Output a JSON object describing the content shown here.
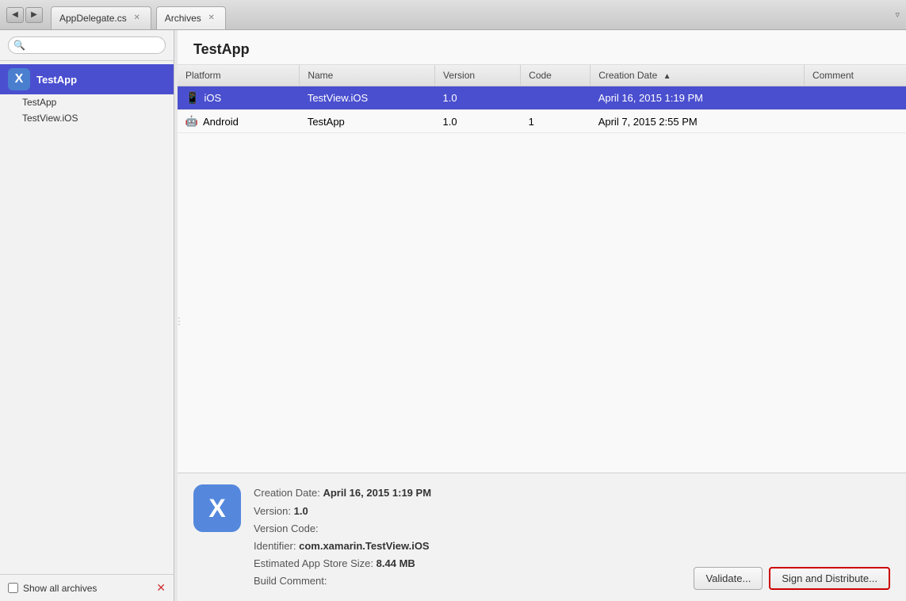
{
  "titleBar": {
    "tabs": [
      {
        "label": "AppDelegate.cs",
        "active": false
      },
      {
        "label": "Archives",
        "active": true
      }
    ]
  },
  "sidebar": {
    "searchPlaceholder": "",
    "groups": [
      {
        "label": "TestApp",
        "icon": "X",
        "children": [
          "TestApp",
          "TestView.iOS"
        ]
      }
    ],
    "showAllLabel": "Show all archives",
    "clearIcon": "✕"
  },
  "content": {
    "title": "TestApp",
    "table": {
      "columns": [
        {
          "label": "Platform",
          "sortable": false
        },
        {
          "label": "Name",
          "sortable": false
        },
        {
          "label": "Version",
          "sortable": false
        },
        {
          "label": "Code",
          "sortable": false
        },
        {
          "label": "Creation Date",
          "sortable": true,
          "sortDir": "asc"
        },
        {
          "label": "Comment",
          "sortable": false
        }
      ],
      "rows": [
        {
          "platform": "iOS",
          "platformIcon": "📱",
          "name": "TestView.iOS",
          "version": "1.0",
          "code": "",
          "creationDate": "April 16, 2015 1:19 PM",
          "comment": "",
          "selected": true
        },
        {
          "platform": "Android",
          "platformIcon": "🤖",
          "name": "TestApp",
          "version": "1.0",
          "code": "1",
          "creationDate": "April 7, 2015 2:55 PM",
          "comment": "",
          "selected": false
        }
      ]
    },
    "detail": {
      "icon": "X",
      "creationDateLabel": "Creation Date:",
      "creationDateValue": "April 16, 2015 1:19 PM",
      "versionLabel": "Version:",
      "versionValue": "1.0",
      "versionCodeLabel": "Version Code:",
      "versionCodeValue": "",
      "identifierLabel": "Identifier:",
      "identifierValue": "com.xamarin.TestView.iOS",
      "estimatedSizeLabel": "Estimated App Store Size:",
      "estimatedSizeValue": "8.44 MB",
      "buildCommentLabel": "Build Comment:",
      "buildCommentValue": ""
    },
    "buttons": {
      "validate": "Validate...",
      "signAndDistribute": "Sign and Distribute..."
    }
  }
}
